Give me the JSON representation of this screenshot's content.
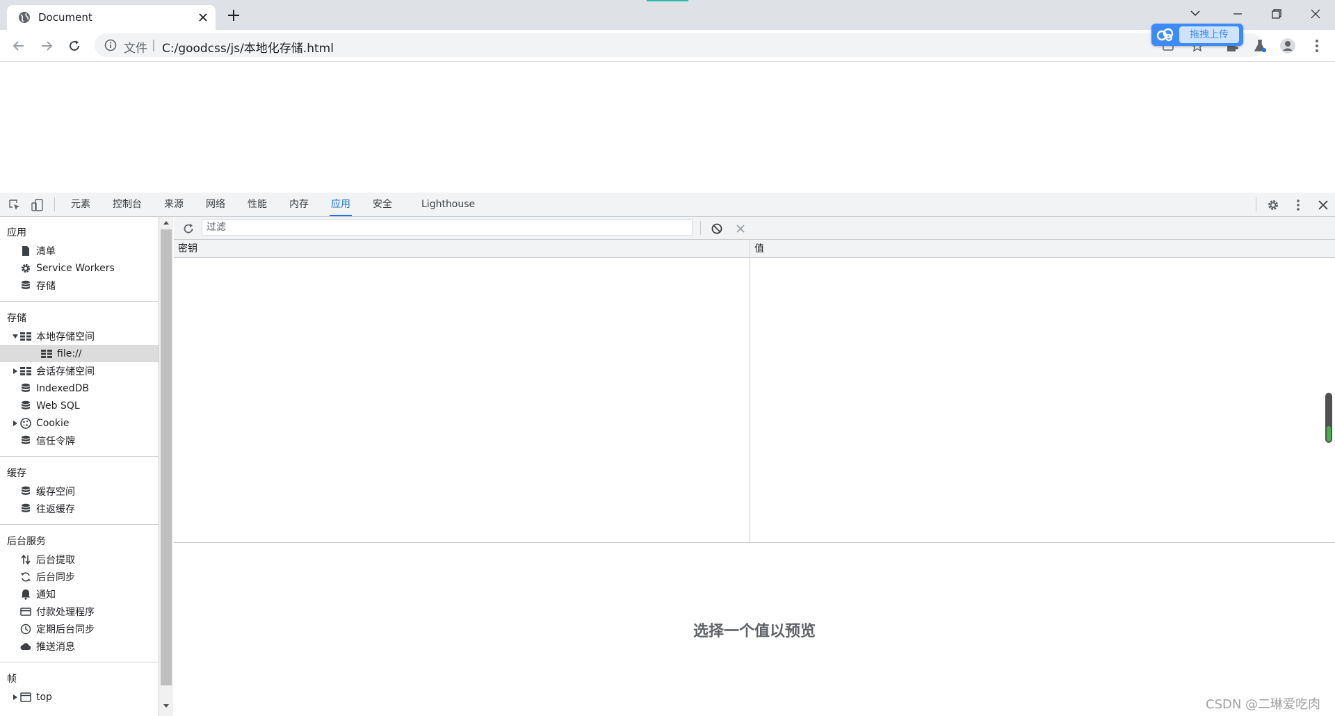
{
  "browser": {
    "tab_title": "Document",
    "address": {
      "scheme_label": "文件",
      "separator": "|",
      "url": "C:/goodcss/js/本地化存储.html"
    },
    "upload_button": "拖拽上传"
  },
  "devtools": {
    "tabs": [
      "元素",
      "控制台",
      "来源",
      "网络",
      "性能",
      "内存",
      "应用",
      "安全",
      "Lighthouse"
    ],
    "active_tab": "应用",
    "sidebar": {
      "sections": [
        {
          "title": "应用",
          "items": [
            {
              "label": "清单",
              "icon": "file-icon"
            },
            {
              "label": "Service Workers",
              "icon": "gear-icon"
            },
            {
              "label": "存储",
              "icon": "database-icon"
            }
          ]
        },
        {
          "title": "存储",
          "items": [
            {
              "label": "本地存储空间",
              "icon": "grid-icon",
              "arrow": "expanded"
            },
            {
              "label": "file://",
              "icon": "grid-icon",
              "selected": true
            },
            {
              "label": "会话存储空间",
              "icon": "grid-icon",
              "arrow": "collapsed"
            },
            {
              "label": "IndexedDB",
              "icon": "database-icon"
            },
            {
              "label": "Web SQL",
              "icon": "database-icon"
            },
            {
              "label": "Cookie",
              "icon": "cookie-icon",
              "arrow": "collapsed"
            },
            {
              "label": "信任令牌",
              "icon": "database-icon"
            }
          ]
        },
        {
          "title": "缓存",
          "items": [
            {
              "label": "缓存空间",
              "icon": "database-icon"
            },
            {
              "label": "往返缓存",
              "icon": "database-icon"
            }
          ]
        },
        {
          "title": "后台服务",
          "items": [
            {
              "label": "后台提取",
              "icon": "arrows-updown-icon"
            },
            {
              "label": "后台同步",
              "icon": "sync-icon"
            },
            {
              "label": "通知",
              "icon": "bell-icon"
            },
            {
              "label": "付款处理程序",
              "icon": "card-icon"
            },
            {
              "label": "定期后台同步",
              "icon": "clock-icon"
            },
            {
              "label": "推送消息",
              "icon": "cloud-icon"
            }
          ]
        },
        {
          "title": "帧",
          "items": [
            {
              "label": "top",
              "icon": "frame-icon",
              "arrow": "collapsed"
            }
          ]
        }
      ]
    },
    "storage_view": {
      "filter_placeholder": "过滤",
      "columns": [
        "密钥",
        "值"
      ],
      "preview_text": "选择一个值以预览"
    }
  },
  "watermark": "CSDN @二琳爱吃肉"
}
